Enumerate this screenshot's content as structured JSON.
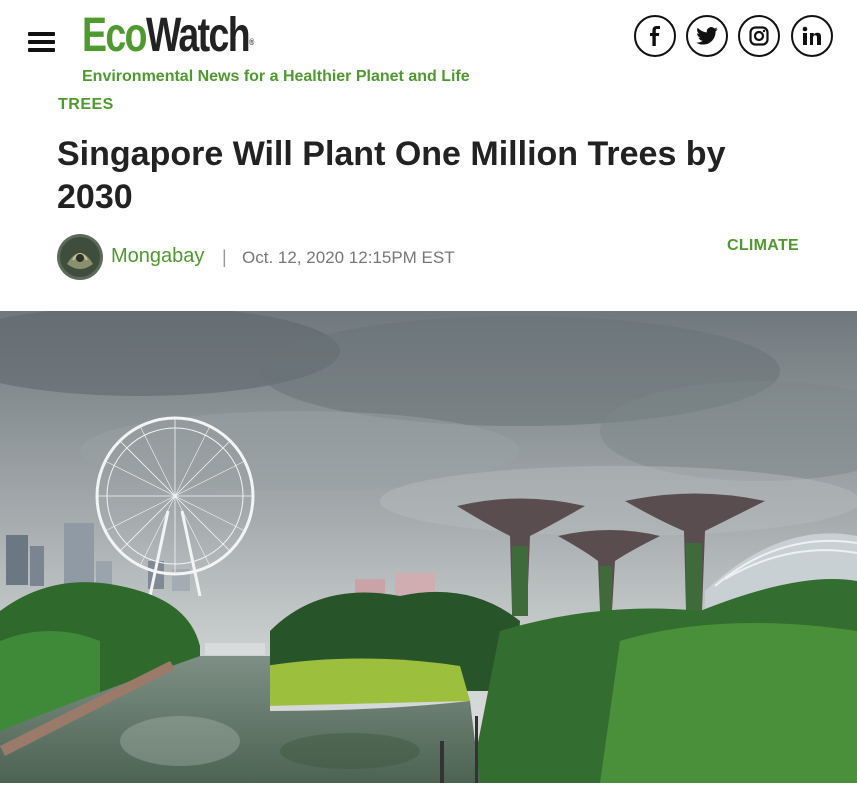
{
  "header": {
    "logo_eco": "Eco",
    "logo_watch": "Watch",
    "logo_mark": "®",
    "tagline": "Environmental News for a Healthier Planet and Life",
    "social": [
      "facebook-icon",
      "twitter-icon",
      "instagram-icon",
      "linkedin-icon"
    ]
  },
  "article": {
    "category": "TREES",
    "title": "Singapore Will Plant One Million Trees by 2030",
    "author": "Mongabay",
    "separator": "|",
    "date": "Oct. 12, 2020 12:15PM EST",
    "tag": "CLIMATE"
  },
  "colors": {
    "brand_green": "#4e9a2f",
    "text_dark": "#222222",
    "meta_gray": "#777777"
  }
}
